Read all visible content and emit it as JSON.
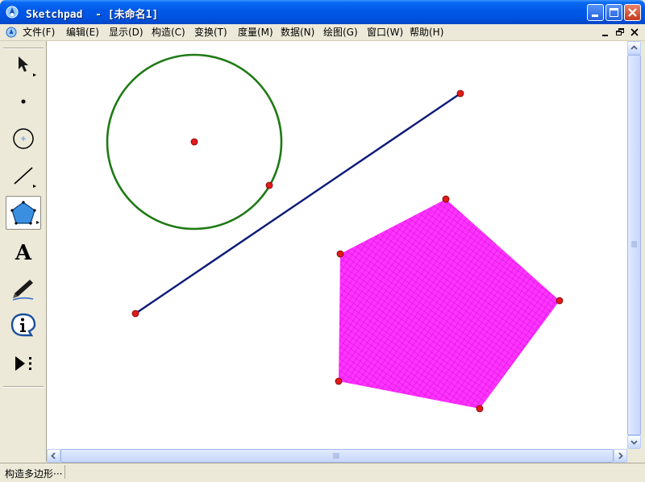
{
  "window": {
    "title": "Sketchpad  - [未命名1]",
    "title_bar_color": "#0054E3",
    "controls": [
      "minimize-icon",
      "maximize-icon",
      "close-icon"
    ]
  },
  "menu": {
    "items": [
      "文件(F)",
      "编辑(E)",
      "显示(D)",
      "构造(C)",
      "变换(T)",
      "度量(M)",
      "数据(N)",
      "绘图(G)",
      "窗口(W)",
      "帮助(H)"
    ],
    "mdi_controls": [
      "minimize-icon",
      "restore-icon",
      "close-icon"
    ]
  },
  "toolbox": {
    "tools": [
      {
        "name": "arrow-tool",
        "icon": "arrow-icon",
        "has_submenu": true
      },
      {
        "name": "point-tool",
        "icon": "point-icon",
        "has_submenu": false
      },
      {
        "name": "compass-tool",
        "icon": "circle-icon",
        "has_submenu": false
      },
      {
        "name": "straightedge-tool",
        "icon": "line-icon",
        "has_submenu": true
      },
      {
        "name": "polygon-tool",
        "icon": "pentagon-icon",
        "has_submenu": true,
        "active": true
      },
      {
        "name": "text-tool",
        "icon": "text-a-icon",
        "has_submenu": false
      },
      {
        "name": "marker-tool",
        "icon": "pen-icon",
        "has_submenu": false
      },
      {
        "name": "information-tool",
        "icon": "info-icon",
        "has_submenu": false
      },
      {
        "name": "custom-tool",
        "icon": "play-menu-icon",
        "has_submenu": false
      }
    ],
    "text_tool_glyph": "A"
  },
  "colors": {
    "circle_stroke": "#1E7A14",
    "segment_stroke": "#0B1A78",
    "polygon_fill": "#FF33FF",
    "polygon_hatch": "#CC00CC",
    "point_fill": "#E01B1B",
    "point_stroke": "#7A0000"
  },
  "status": {
    "text": "构造多边形···"
  }
}
